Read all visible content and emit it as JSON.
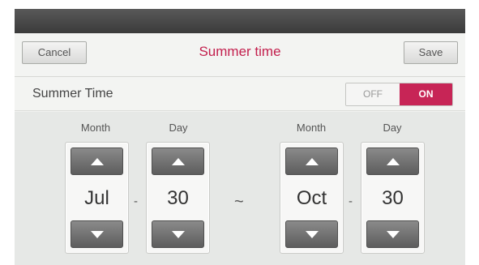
{
  "header": {
    "cancel_label": "Cancel",
    "title": "Summer time",
    "save_label": "Save"
  },
  "summer_time": {
    "label": "Summer Time",
    "off_label": "OFF",
    "on_label": "ON",
    "state": "ON"
  },
  "period": {
    "start": {
      "month_label": "Month",
      "day_label": "Day",
      "month": "Jul",
      "day": "30"
    },
    "separator": "-",
    "range_symbol": "~",
    "end": {
      "month_label": "Month",
      "day_label": "Day",
      "month": "Oct",
      "day": "30"
    }
  },
  "colors": {
    "accent": "#c72556",
    "title": "#c3204e",
    "top_bar": "#4a4a4a",
    "spinner_button": "#6e6e6e"
  },
  "icons": {
    "increment": "triangle-up-icon",
    "decrement": "triangle-down-icon"
  }
}
